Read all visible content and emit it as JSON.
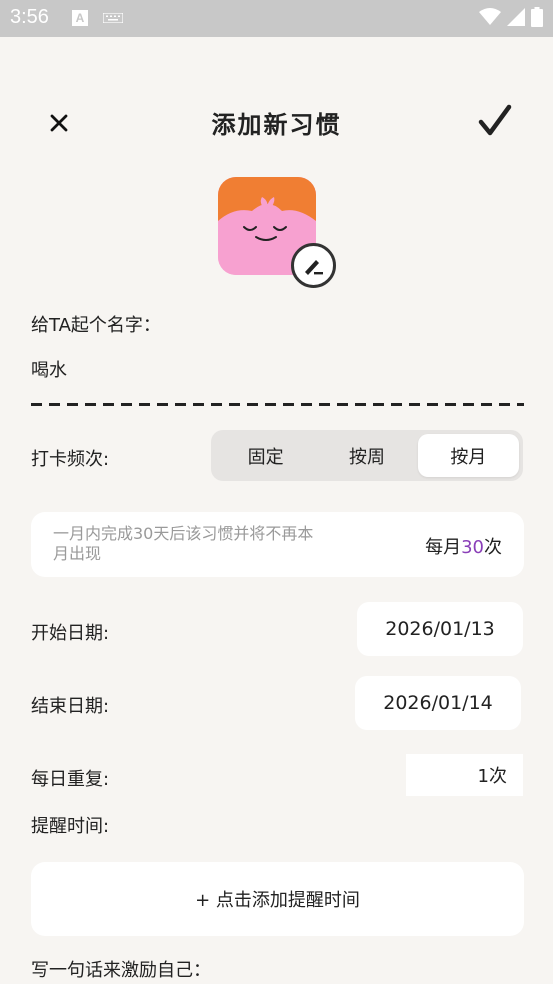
{
  "status_bar": {
    "time": "3:56",
    "a_badge": "A",
    "icons": [
      "keyboard-icon",
      "wifi-icon",
      "signal-icon",
      "battery-icon"
    ]
  },
  "header": {
    "title": "添加新习惯",
    "close_icon": "×"
  },
  "name_section": {
    "label": "给TA起个名字：",
    "value": "喝水"
  },
  "frequency": {
    "label": "打卡频次:",
    "options": [
      "固定",
      "按周",
      "按月"
    ],
    "selected": "按月"
  },
  "info_card": {
    "description": "一月内完成30天后该习惯并将不再本月出现",
    "prefix": "每月",
    "count": "30",
    "suffix": "次"
  },
  "start_date": {
    "label": "开始日期:",
    "value": "2026/01/13"
  },
  "end_date": {
    "label": "结束日期:",
    "value": "2026/01/14"
  },
  "daily_repeat": {
    "label": "每日重复:",
    "value": "1次"
  },
  "reminder": {
    "label": "提醒时间:",
    "button": "+ 点击添加提醒时间"
  },
  "motivation": {
    "label": "写一句话来激励自己："
  },
  "colors": {
    "accent_purple": "#8a3fb8",
    "icon_pink": "#f7a1d0",
    "icon_orange": "#f07e33",
    "background": "#f7f5f2"
  }
}
